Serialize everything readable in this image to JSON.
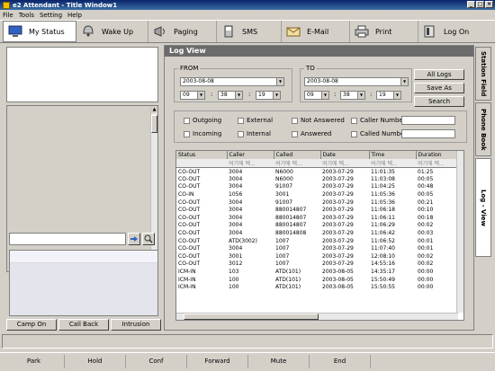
{
  "window": {
    "title": "e2 Attendant - Title Window1"
  },
  "menu": [
    "File",
    "Tools",
    "Setting",
    "Help"
  ],
  "toolbar": {
    "my_status": "My Status",
    "wake_up": "Wake Up",
    "paging": "Paging",
    "sms": "SMS",
    "email": "E-Mail",
    "print": "Print",
    "log_on": "Log On"
  },
  "left": {
    "buttons": {
      "camp_on": "Camp On",
      "call_back": "Call Back",
      "intrusion": "Intrusion"
    }
  },
  "logview": {
    "header": "Log View",
    "from_label": "FROM",
    "to_label": "TO",
    "from": {
      "date": "2003-08-08",
      "hour": "09",
      "minute": "38",
      "second": "19"
    },
    "to": {
      "date": "2003-08-08",
      "hour": "09",
      "minute": "38",
      "second": "19"
    },
    "buttons": {
      "all_logs": "All Logs",
      "save_as": "Save As",
      "search": "Search"
    },
    "filters": {
      "outgoing": "Outgoing",
      "external": "External",
      "not_answered": "Not Answered",
      "caller_number": "Caller Number",
      "incoming": "Incoming",
      "internal": "Internal",
      "answered": "Answered",
      "called_number": "Called Number"
    },
    "columns": [
      "Status",
      "Caller",
      "Called",
      "Date",
      "Time",
      "Duration"
    ],
    "filter_row": [
      "",
      "여기에 텍...",
      "여기에 텍...",
      "여기에 텍...",
      "여기에 텍...",
      "여기에 텍..."
    ],
    "rows": [
      [
        "CO-OUT",
        "3004",
        "N6000",
        "2003-07-29",
        "11:01:35",
        "01:25"
      ],
      [
        "CO-OUT",
        "3004",
        "N6000",
        "2003-07-29",
        "11:03:08",
        "00:05"
      ],
      [
        "CO-OUT",
        "3004",
        "91007",
        "2003-07-29",
        "11:04:25",
        "00:48"
      ],
      [
        "CO-IN",
        "1056",
        "3001",
        "2003-07-29",
        "11:05:36",
        "00:05"
      ],
      [
        "CO-OUT",
        "3004",
        "91007",
        "2003-07-29",
        "11:05:36",
        "00:21"
      ],
      [
        "CO-OUT",
        "3004",
        "880014807",
        "2003-07-29",
        "11:06:18",
        "00:10"
      ],
      [
        "CO-OUT",
        "3004",
        "880014807",
        "2003-07-29",
        "11:06:11",
        "00:18"
      ],
      [
        "CO-OUT",
        "3004",
        "880014807",
        "2003-07-29",
        "11:06:29",
        "00:02"
      ],
      [
        "CO-OUT",
        "3004",
        "880014808",
        "2003-07-29",
        "11:06:42",
        "00:03"
      ],
      [
        "CO-OUT",
        "ATD(3002)",
        "1007",
        "2003-07-29",
        "11:06:52",
        "00:01"
      ],
      [
        "CO-OUT",
        "3004",
        "1007",
        "2003-07-29",
        "11:07:40",
        "00:01"
      ],
      [
        "CO-OUT",
        "3001",
        "1007",
        "2003-07-29",
        "12:08:10",
        "00:02"
      ],
      [
        "CO-OUT",
        "3012",
        "1007",
        "2003-07-29",
        "14:55:16",
        "00:02"
      ],
      [
        "ICM-IN",
        "103",
        "ATD(101)",
        "2003-08-05",
        "14:35:17",
        "00:00"
      ],
      [
        "ICM-IN",
        "100",
        "ATD(101)",
        "2003-08-05",
        "15:50:49",
        "00:00"
      ],
      [
        "ICM-IN",
        "100",
        "ATD(101)",
        "2003-08-05",
        "15:50:55",
        "00:00"
      ]
    ]
  },
  "vtabs": [
    "Station Field",
    "Phone Book",
    "Log - View"
  ],
  "bottom": [
    "Park",
    "Hold",
    "Conf",
    "Forward",
    "Mute",
    "End"
  ]
}
